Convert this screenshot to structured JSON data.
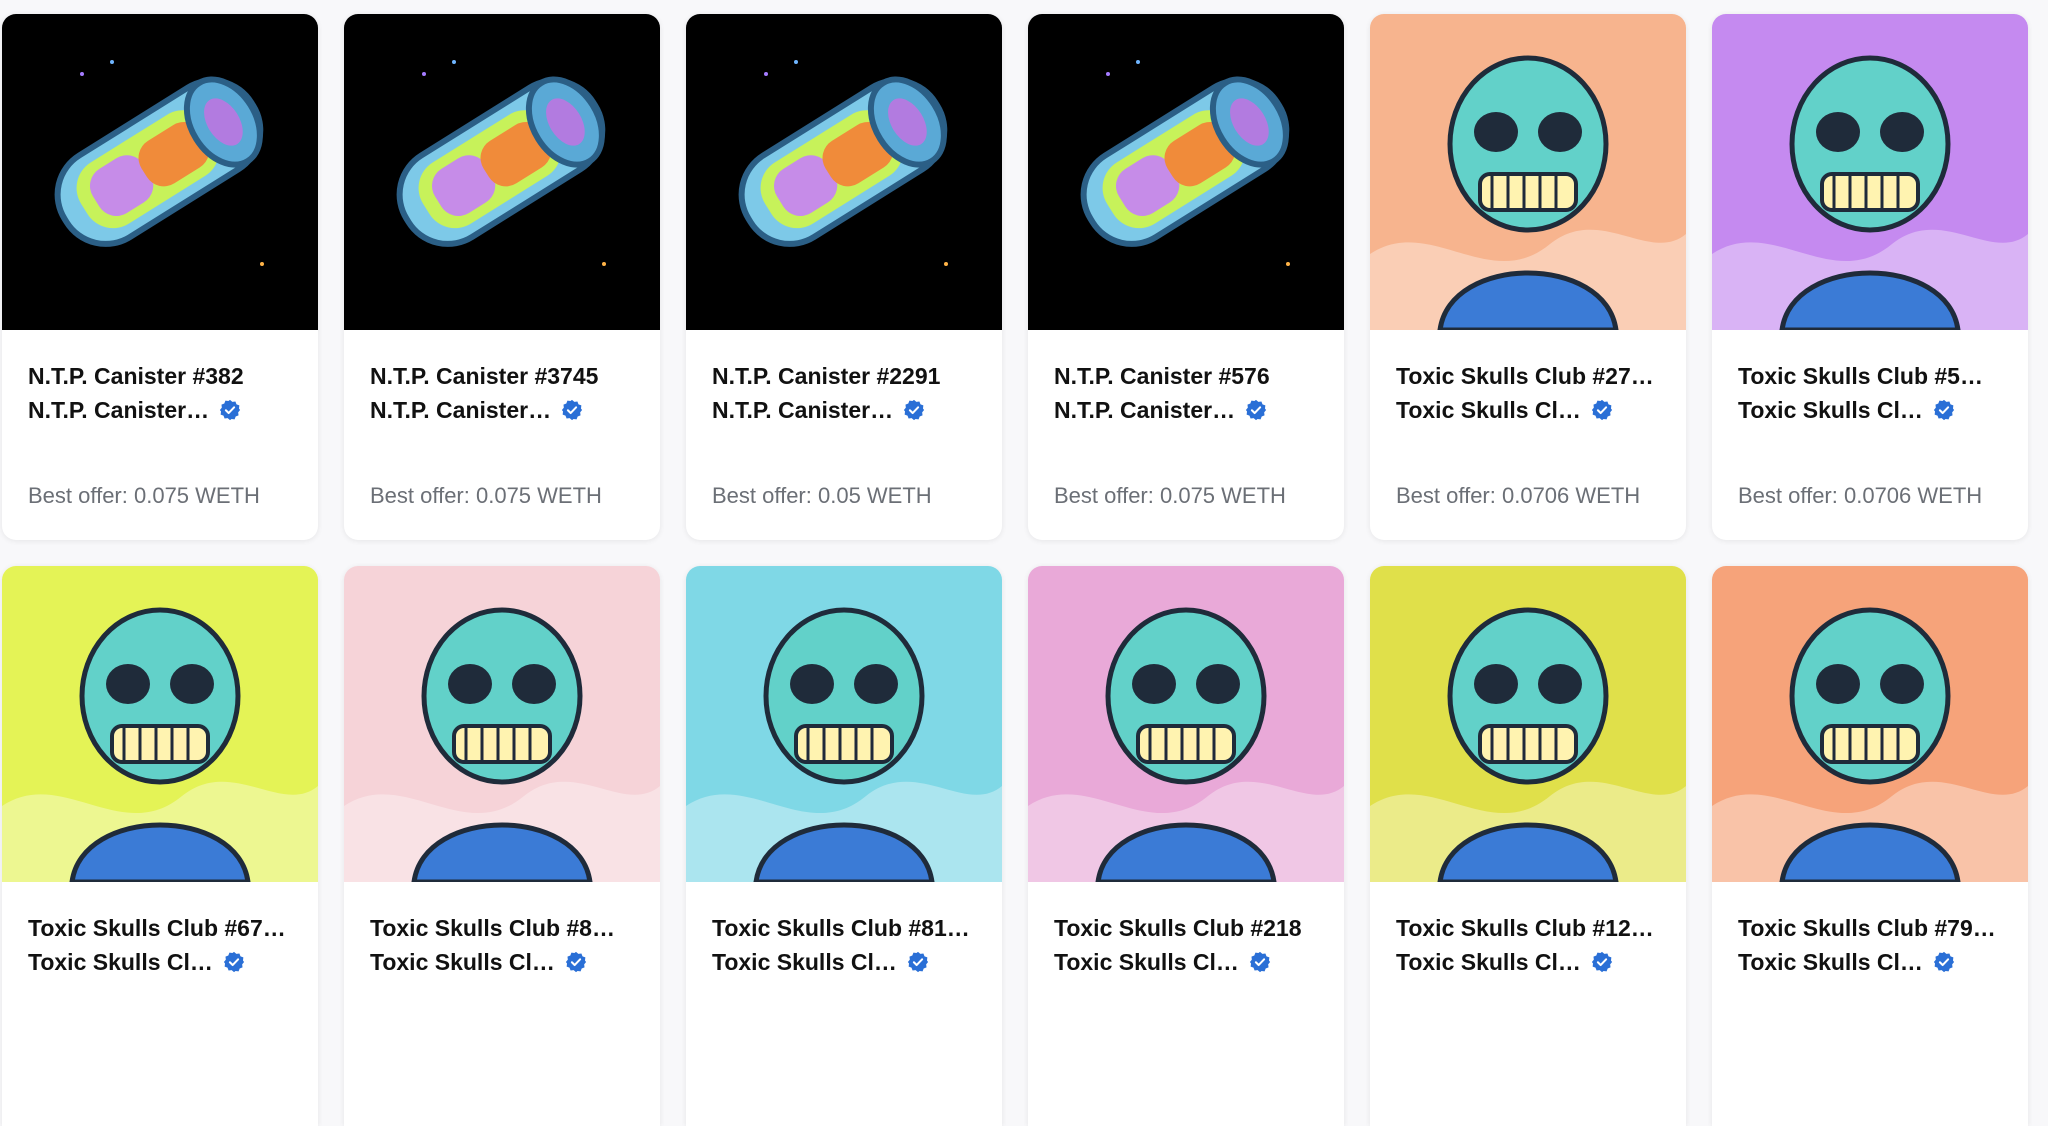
{
  "colors": {
    "verified": "#2a6fd6",
    "text": "#111111",
    "muted": "#6b6f76",
    "card_bg": "#ffffff"
  },
  "icons": {
    "verified": "verified-badge-icon"
  },
  "rows": [
    [
      {
        "title": "N.T.P. Canister #382",
        "collection": "N.T.P. Canister…",
        "offer": "Best offer: 0.075 WETH",
        "art": "canister",
        "bg": "#000000"
      },
      {
        "title": "N.T.P. Canister #3745",
        "collection": "N.T.P. Canister…",
        "offer": "Best offer: 0.075 WETH",
        "art": "canister",
        "bg": "#000000"
      },
      {
        "title": "N.T.P. Canister #2291",
        "collection": "N.T.P. Canister…",
        "offer": "Best offer: 0.05 WETH",
        "art": "canister",
        "bg": "#000000"
      },
      {
        "title": "N.T.P. Canister #576",
        "collection": "N.T.P. Canister…",
        "offer": "Best offer: 0.075 WETH",
        "art": "canister",
        "bg": "#000000"
      },
      {
        "title": "Toxic Skulls Club #27…",
        "collection": "Toxic Skulls Cl…",
        "offer": "Best offer: 0.0706 WETH",
        "art": "skull",
        "bg": "#f7b48e"
      },
      {
        "title": "Toxic Skulls Club #5…",
        "collection": "Toxic Skulls Cl…",
        "offer": "Best offer: 0.0706 WETH",
        "art": "skull",
        "bg": "#c58af0"
      }
    ],
    [
      {
        "title": "Toxic Skulls Club #67…",
        "collection": "Toxic Skulls Cl…",
        "art": "skull",
        "bg": "#e4f356"
      },
      {
        "title": "Toxic Skulls Club #8…",
        "collection": "Toxic Skulls Cl…",
        "art": "skull",
        "bg": "#f6d3d8"
      },
      {
        "title": "Toxic Skulls Club #81…",
        "collection": "Toxic Skulls Cl…",
        "art": "skull",
        "bg": "#7fd8e6"
      },
      {
        "title": "Toxic Skulls Club #218",
        "collection": "Toxic Skulls Cl…",
        "art": "skull",
        "bg": "#e9a9d8"
      },
      {
        "title": "Toxic Skulls Club #12…",
        "collection": "Toxic Skulls Cl…",
        "art": "skull",
        "bg": "#e0e04a"
      },
      {
        "title": "Toxic Skulls Club #79…",
        "collection": "Toxic Skulls Cl…",
        "art": "skull",
        "bg": "#f6a37a"
      }
    ]
  ]
}
